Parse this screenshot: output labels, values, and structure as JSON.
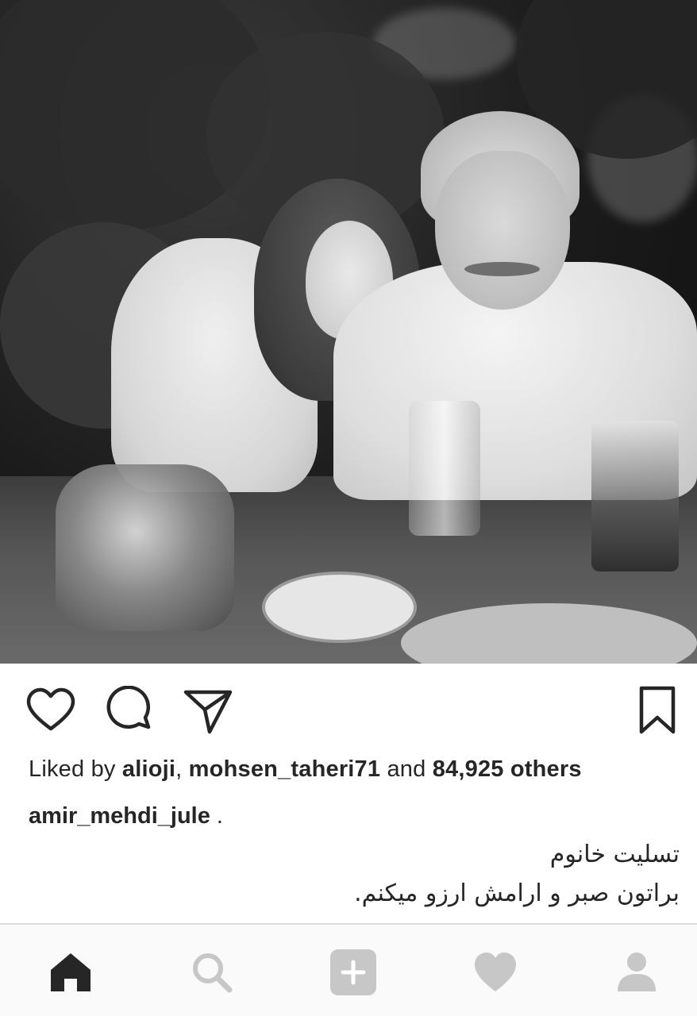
{
  "post": {
    "likes": {
      "prefix": "Liked by ",
      "user1": "alioji",
      "separator": ", ",
      "user2": "mohsen_taheri71",
      "conjunction": " and ",
      "count": "84,925 others"
    },
    "comment": {
      "username": "amir_mehdi_jule",
      "username_suffix": " .",
      "line1": "تسلیت خانوم",
      "line2": "براتون صبر و ارامش ارزو میکنم."
    }
  },
  "icons": {
    "like": "heart-outline-icon",
    "comment": "comment-bubble-icon",
    "share": "send-plane-icon",
    "save": "bookmark-icon"
  },
  "nav": {
    "items": [
      {
        "name": "home",
        "icon": "home-icon",
        "active": true
      },
      {
        "name": "search",
        "icon": "search-icon",
        "active": false
      },
      {
        "name": "new-post",
        "icon": "plus-square-icon",
        "active": false
      },
      {
        "name": "activity",
        "icon": "heart-filled-icon",
        "active": false
      },
      {
        "name": "profile",
        "icon": "person-icon",
        "active": false
      }
    ]
  },
  "colors": {
    "text": "#262626",
    "inactive_icon": "#c7c7c7",
    "nav_bg": "#fafafa",
    "divider": "#dbdbdb"
  }
}
